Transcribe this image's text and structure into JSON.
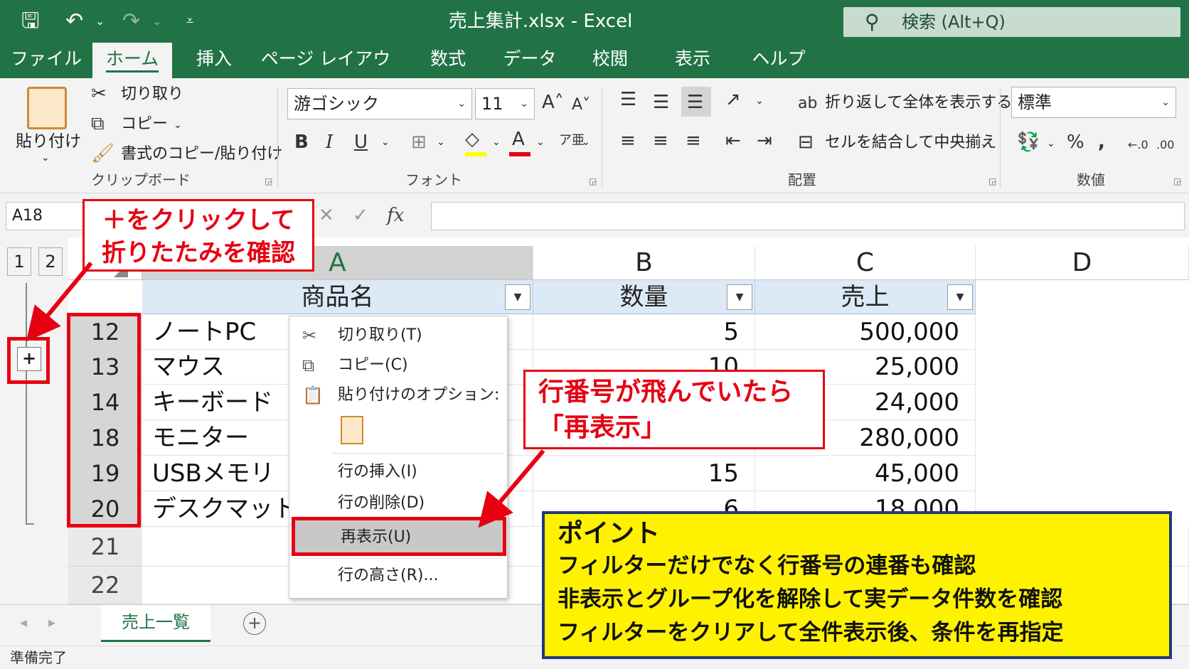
{
  "window": {
    "title": "売上集計.xlsx  -  Excel",
    "search_placeholder": "検索 (Alt+Q)",
    "quick_access": [
      "save",
      "undo",
      "redo",
      "customize"
    ]
  },
  "tabs": [
    "ファイル",
    "ホーム",
    "挿入",
    "ページ レイアウト",
    "数式",
    "データ",
    "校閲",
    "表示",
    "ヘルプ"
  ],
  "active_tab": "ホーム",
  "ribbon": {
    "clipboard": {
      "paste": "貼り付け",
      "cut": "切り取り",
      "copy": "コピー",
      "format_painter": "書式のコピー/貼り付け",
      "label": "クリップボード"
    },
    "font": {
      "font_name": "游ゴシック",
      "font_size": "11",
      "label": "フォント"
    },
    "alignment": {
      "wrap_text": "折り返して全体を表示する",
      "merge_center": "セルを結合して中央揃え",
      "label": "配置"
    },
    "number": {
      "format": "標準",
      "label": "数値"
    }
  },
  "formula_bar": {
    "name_box": "A18",
    "fx": "fx"
  },
  "outline_levels": [
    "1",
    "2"
  ],
  "columns": [
    "A",
    "B",
    "C",
    "D"
  ],
  "table": {
    "headers": [
      "商品名",
      "数量",
      "売上"
    ],
    "rows": [
      {
        "row": "12",
        "name": "ノートPC",
        "qty": "5",
        "sales": "500,000"
      },
      {
        "row": "13",
        "name": "マウス",
        "qty": "10",
        "sales": "25,000"
      },
      {
        "row": "14",
        "name": "キーボード",
        "qty": "",
        "sales": "24,000"
      },
      {
        "row": "18",
        "name": "モニター",
        "qty": "",
        "sales": "280,000"
      },
      {
        "row": "19",
        "name": "USBメモリ",
        "qty": "15",
        "sales": "45,000"
      },
      {
        "row": "20",
        "name": "デスクマット",
        "qty": "6",
        "sales": "18,000"
      }
    ],
    "empty_rows": [
      "21",
      "22"
    ]
  },
  "context_menu": {
    "items": [
      "切り取り(T)",
      "コピー(C)",
      "貼り付けのオプション:",
      "行の挿入(I)",
      "行の削除(D)",
      "再表示(U)",
      "行の高さ(R)..."
    ],
    "highlighted": "再表示(U)"
  },
  "sheet_tabs": [
    "売上一覧"
  ],
  "status": "準備完了",
  "annotations": {
    "callout1": [
      "＋をクリックして",
      "折りたたみを確認"
    ],
    "callout2": [
      "行番号が飛んでいたら",
      "「再表示」"
    ],
    "point_title": "ポイント",
    "point_lines": [
      "フィルターだけでなく行番号の連番も確認",
      "非表示とグループ化を解除して実データ件数を確認",
      "フィルターをクリアして全件表示後、条件を再指定"
    ]
  },
  "colors": {
    "excel_green": "#217346",
    "annotation_red": "#e60012",
    "point_yellow": "#fff200",
    "point_border": "#1f3a7a"
  }
}
